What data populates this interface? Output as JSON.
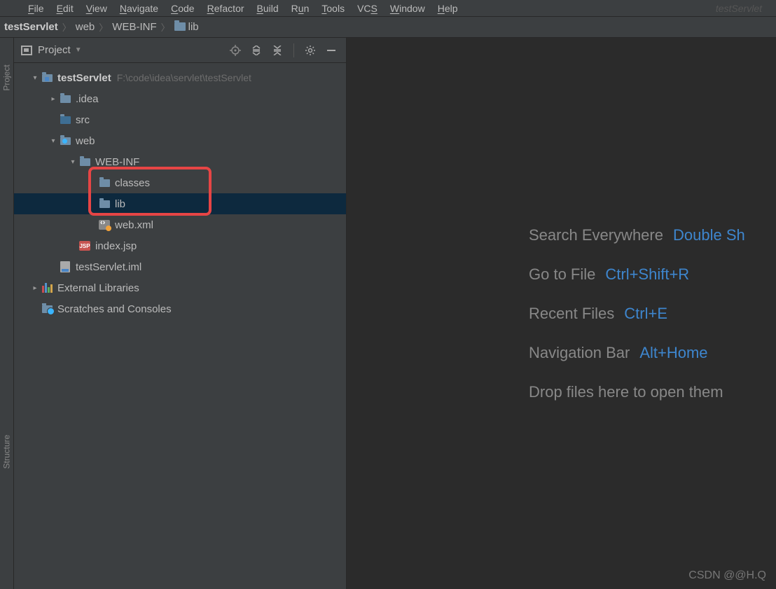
{
  "menubar": {
    "items": [
      {
        "label": "File",
        "mn": "F",
        "rest": "ile"
      },
      {
        "label": "Edit",
        "mn": "E",
        "rest": "dit"
      },
      {
        "label": "View",
        "mn": "V",
        "rest": "iew"
      },
      {
        "label": "Navigate",
        "mn": "N",
        "rest": "avigate"
      },
      {
        "label": "Code",
        "mn": "C",
        "rest": "ode"
      },
      {
        "label": "Refactor",
        "mn": "R",
        "rest": "efactor"
      },
      {
        "label": "Build",
        "mn": "B",
        "rest": "uild"
      },
      {
        "label": "Run",
        "mn": "R",
        "rest": "un",
        "pre": "R",
        "pos": "n",
        "mid": "u"
      },
      {
        "label": "Tools",
        "mn": "T",
        "rest": "ools"
      },
      {
        "label": "VCS",
        "mn": "S",
        "pre": "VC",
        "rest": ""
      },
      {
        "label": "Window",
        "mn": "W",
        "rest": "indow"
      },
      {
        "label": "Help",
        "mn": "H",
        "rest": "elp"
      }
    ],
    "search_placeholder": "testServlet"
  },
  "breadcrumb": {
    "items": [
      "testServlet",
      "web",
      "WEB-INF",
      "lib"
    ]
  },
  "panel": {
    "title": "Project"
  },
  "tree": {
    "root": {
      "label": "testServlet",
      "hint": "F:\\code\\idea\\servlet\\testServlet"
    },
    "idea": {
      "label": ".idea"
    },
    "src": {
      "label": "src"
    },
    "web": {
      "label": "web"
    },
    "webinf": {
      "label": "WEB-INF"
    },
    "classes": {
      "label": "classes"
    },
    "lib": {
      "label": "lib"
    },
    "webxml": {
      "label": "web.xml"
    },
    "indexjsp": {
      "label": "index.jsp"
    },
    "iml": {
      "label": "testServlet.iml"
    },
    "extlib": {
      "label": "External Libraries"
    },
    "scratches": {
      "label": "Scratches and Consoles"
    }
  },
  "editor_hints": {
    "search": {
      "label": "Search Everywhere",
      "shortcut": "Double Sh"
    },
    "gotofile": {
      "label": "Go to File",
      "shortcut": "Ctrl+Shift+R"
    },
    "recent": {
      "label": "Recent Files",
      "shortcut": "Ctrl+E"
    },
    "nav": {
      "label": "Navigation Bar",
      "shortcut": "Alt+Home"
    },
    "drop": {
      "label": "Drop files here to open them"
    }
  },
  "leftstrip": {
    "project": "Project",
    "structure": "Structure"
  },
  "watermark": "CSDN @@H.Q"
}
